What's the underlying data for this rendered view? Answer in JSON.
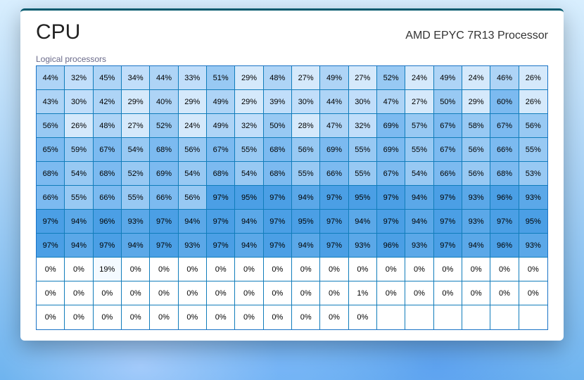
{
  "header": {
    "title": "CPU",
    "model": "AMD EPYC 7R13 Processor",
    "subtitle": "Logical processors"
  },
  "grid": {
    "columns": 18,
    "rows": 11,
    "total_cells": 192,
    "unit": "%",
    "values": [
      [
        44,
        32,
        45,
        34,
        44,
        33,
        51,
        29,
        48,
        27,
        49,
        27,
        52,
        24,
        49,
        24,
        46,
        26
      ],
      [
        43,
        30,
        42,
        29,
        40,
        29,
        49,
        29,
        39,
        30,
        44,
        30,
        47,
        27,
        50,
        29,
        60,
        26
      ],
      [
        56,
        26,
        48,
        27,
        52,
        24,
        49,
        32,
        50,
        28,
        47,
        32,
        69,
        57,
        67,
        58,
        67,
        56
      ],
      [
        65,
        59,
        67,
        54,
        68,
        56,
        67,
        55,
        68,
        56,
        69,
        55,
        69,
        55,
        67,
        56,
        66,
        55
      ],
      [
        68,
        54,
        68,
        52,
        69,
        54,
        68,
        54,
        68,
        55,
        66,
        55,
        67,
        54,
        66,
        56,
        68,
        53
      ],
      [
        66,
        55,
        66,
        55,
        66,
        56,
        97,
        95,
        97,
        94,
        97,
        95,
        97,
        94,
        97,
        93,
        96,
        93
      ],
      [
        97,
        94,
        96,
        93,
        97,
        94,
        97,
        94,
        97,
        95,
        97,
        94,
        97,
        94,
        97,
        93,
        97,
        95
      ],
      [
        97,
        94,
        97,
        94,
        97,
        93,
        97,
        94,
        97,
        94,
        97,
        93,
        96,
        93,
        97,
        94,
        96,
        93
      ],
      [
        0,
        0,
        19,
        0,
        0,
        0,
        0,
        0,
        0,
        0,
        0,
        0,
        0,
        0,
        0,
        0,
        0,
        0
      ],
      [
        0,
        0,
        0,
        0,
        0,
        0,
        0,
        0,
        0,
        0,
        0,
        1,
        0,
        0,
        0,
        0,
        0,
        0
      ],
      [
        0,
        0,
        0,
        0,
        0,
        0,
        0,
        0,
        0,
        0,
        0,
        0
      ]
    ]
  }
}
